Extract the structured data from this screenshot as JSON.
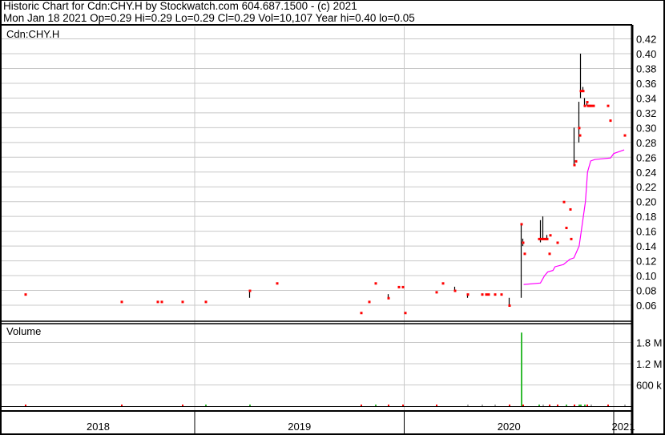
{
  "header": {
    "title": "Historic Chart for Cdn:CHY.H by Stockwatch.com 604.687.1500 - (c) 2021",
    "quote": "Mon Jan 18 2021  Op=0.29  Hi=0.29  Lo=0.29  Cl=0.29  Vol=10,107  Year hi=0.40  lo=0.05"
  },
  "colors": {
    "bar": "#000000",
    "close": "#ff0000",
    "ma": "#ff00ff",
    "vol_up": "#33bb33",
    "vol_down": "#ff0000",
    "vol_flat": "#aaaaaa",
    "grid": "#c8c8c8"
  },
  "chart_data": {
    "type": "ohlc",
    "symbol_label": "Cdn:CHY.H",
    "volume_label": "Volume",
    "price_ylim": [
      0.04,
      0.44
    ],
    "price_ticks": [
      "0.06",
      "0.08",
      "0.10",
      "0.12",
      "0.14",
      "0.16",
      "0.18",
      "0.20",
      "0.22",
      "0.24",
      "0.26",
      "0.28",
      "0.30",
      "0.32",
      "0.34",
      "0.36",
      "0.38",
      "0.40",
      "0.42"
    ],
    "volume_ticks": [
      {
        "label": "600 k",
        "value": 600000
      },
      {
        "label": "1.2 M",
        "value": 1200000
      },
      {
        "label": "1.8 M",
        "value": 1800000
      }
    ],
    "x_range": [
      2017.93,
      2021.09
    ],
    "years": [
      {
        "label": "2018",
        "start": 2018
      },
      {
        "label": "2019",
        "start": 2019
      },
      {
        "label": "2020",
        "start": 2020
      },
      {
        "label": "2021",
        "start": 2021
      }
    ],
    "bars": [
      [
        2018.19,
        0.075,
        0.075,
        0.075
      ],
      [
        2018.65,
        0.065,
        0.065,
        0.065
      ],
      [
        2018.82,
        0.065,
        0.065,
        0.065
      ],
      [
        2018.84,
        0.065,
        0.065,
        0.065
      ],
      [
        2018.94,
        0.065,
        0.065,
        0.065
      ],
      [
        2019.05,
        0.065,
        0.065,
        0.065
      ],
      [
        2019.26,
        0.08,
        0.07,
        0.08
      ],
      [
        2019.39,
        0.09,
        0.09,
        0.09
      ],
      [
        2019.79,
        0.05,
        0.05,
        0.05
      ],
      [
        2019.83,
        0.065,
        0.065,
        0.065
      ],
      [
        2019.86,
        0.09,
        0.09,
        0.09
      ],
      [
        2019.92,
        0.075,
        0.07,
        0.07
      ],
      [
        2019.97,
        0.085,
        0.085,
        0.085
      ],
      [
        2019.99,
        0.085,
        0.085,
        0.085
      ],
      [
        2020.0,
        0.05,
        0.05,
        0.05
      ],
      [
        2020.15,
        0.078,
        0.078,
        0.078
      ],
      [
        2020.18,
        0.09,
        0.09,
        0.09
      ],
      [
        2020.24,
        0.085,
        0.08,
        0.08
      ],
      [
        2020.3,
        0.075,
        0.07,
        0.075
      ],
      [
        2020.37,
        0.075,
        0.075,
        0.075
      ],
      [
        2020.39,
        0.075,
        0.075,
        0.075
      ],
      [
        2020.4,
        0.075,
        0.075,
        0.075
      ],
      [
        2020.43,
        0.075,
        0.075,
        0.075
      ],
      [
        2020.46,
        0.075,
        0.075,
        0.075
      ],
      [
        2020.5,
        0.07,
        0.06,
        0.06
      ],
      [
        2020.555,
        0.17,
        0.07,
        0.17
      ],
      [
        2020.565,
        0.15,
        0.14,
        0.145
      ],
      [
        2020.57,
        0.13,
        0.13,
        0.13
      ],
      [
        2020.64,
        0.15,
        0.15,
        0.15
      ],
      [
        2020.65,
        0.175,
        0.145,
        0.15
      ],
      [
        2020.66,
        0.18,
        0.15,
        0.15
      ],
      [
        2020.67,
        0.15,
        0.15,
        0.15
      ],
      [
        2020.68,
        0.155,
        0.15,
        0.15
      ],
      [
        2020.69,
        0.13,
        0.13,
        0.13
      ],
      [
        2020.695,
        0.155,
        0.155,
        0.155
      ],
      [
        2020.73,
        0.145,
        0.145,
        0.145
      ],
      [
        2020.76,
        0.2,
        0.2,
        0.2
      ],
      [
        2020.77,
        0.165,
        0.165,
        0.165
      ],
      [
        2020.79,
        0.19,
        0.19,
        0.19
      ],
      [
        2020.795,
        0.15,
        0.15,
        0.15
      ],
      [
        2020.81,
        0.3,
        0.25,
        0.25
      ],
      [
        2020.815,
        0.255,
        0.255,
        0.255
      ],
      [
        2020.83,
        0.335,
        0.28,
        0.3
      ],
      [
        2020.835,
        0.29,
        0.29,
        0.29
      ],
      [
        2020.84,
        0.4,
        0.34,
        0.35
      ],
      [
        2020.85,
        0.355,
        0.35,
        0.35
      ],
      [
        2020.86,
        0.34,
        0.33,
        0.33
      ],
      [
        2020.87,
        0.335,
        0.33,
        0.335
      ],
      [
        2020.875,
        0.33,
        0.33,
        0.33
      ],
      [
        2020.88,
        0.33,
        0.33,
        0.33
      ],
      [
        2020.89,
        0.33,
        0.33,
        0.33
      ],
      [
        2020.9,
        0.33,
        0.33,
        0.33
      ],
      [
        2020.97,
        0.33,
        0.33,
        0.33
      ],
      [
        2020.98,
        0.31,
        0.31,
        0.31
      ],
      [
        2021.05,
        0.29,
        0.29,
        0.29
      ]
    ],
    "bar_columns": [
      "date",
      "high",
      "low",
      "close"
    ],
    "moving_average": [
      [
        2020.57,
        0.088
      ],
      [
        2020.65,
        0.09
      ],
      [
        2020.67,
        0.1
      ],
      [
        2020.685,
        0.105
      ],
      [
        2020.71,
        0.107
      ],
      [
        2020.72,
        0.112
      ],
      [
        2020.76,
        0.115
      ],
      [
        2020.79,
        0.122
      ],
      [
        2020.81,
        0.124
      ],
      [
        2020.835,
        0.14
      ],
      [
        2020.845,
        0.16
      ],
      [
        2020.865,
        0.2
      ],
      [
        2020.875,
        0.24
      ],
      [
        2020.89,
        0.255
      ],
      [
        2020.91,
        0.257
      ],
      [
        2020.985,
        0.259
      ],
      [
        2021.0,
        0.265
      ],
      [
        2021.05,
        0.27
      ]
    ],
    "volume": [
      [
        2018.19,
        8000,
        "down"
      ],
      [
        2018.65,
        10000,
        "down"
      ],
      [
        2018.94,
        8000,
        "down"
      ],
      [
        2019.05,
        15000,
        "up"
      ],
      [
        2019.26,
        20000,
        "up"
      ],
      [
        2019.79,
        12000,
        "down"
      ],
      [
        2019.86,
        20000,
        "up"
      ],
      [
        2019.92,
        15000,
        "down"
      ],
      [
        2019.99,
        18000,
        "down"
      ],
      [
        2020.15,
        25000,
        "down"
      ],
      [
        2020.3,
        30000,
        "flat"
      ],
      [
        2020.37,
        25000,
        "flat"
      ],
      [
        2020.43,
        30000,
        "flat"
      ],
      [
        2020.5,
        35000,
        "down"
      ],
      [
        2020.555,
        2080000,
        "up"
      ],
      [
        2020.565,
        20000,
        "down"
      ],
      [
        2020.64,
        15000,
        "up"
      ],
      [
        2020.66,
        25000,
        "flat"
      ],
      [
        2020.69,
        15000,
        "down"
      ],
      [
        2020.73,
        12000,
        "down"
      ],
      [
        2020.77,
        15000,
        "up"
      ],
      [
        2020.81,
        30000,
        "down"
      ],
      [
        2020.83,
        45000,
        "up"
      ],
      [
        2020.84,
        35000,
        "up"
      ],
      [
        2020.86,
        45000,
        "up"
      ],
      [
        2020.87,
        30000,
        "down"
      ],
      [
        2020.89,
        25000,
        "flat"
      ],
      [
        2020.97,
        10000,
        "down"
      ],
      [
        2021.05,
        10107,
        "flat"
      ]
    ]
  }
}
